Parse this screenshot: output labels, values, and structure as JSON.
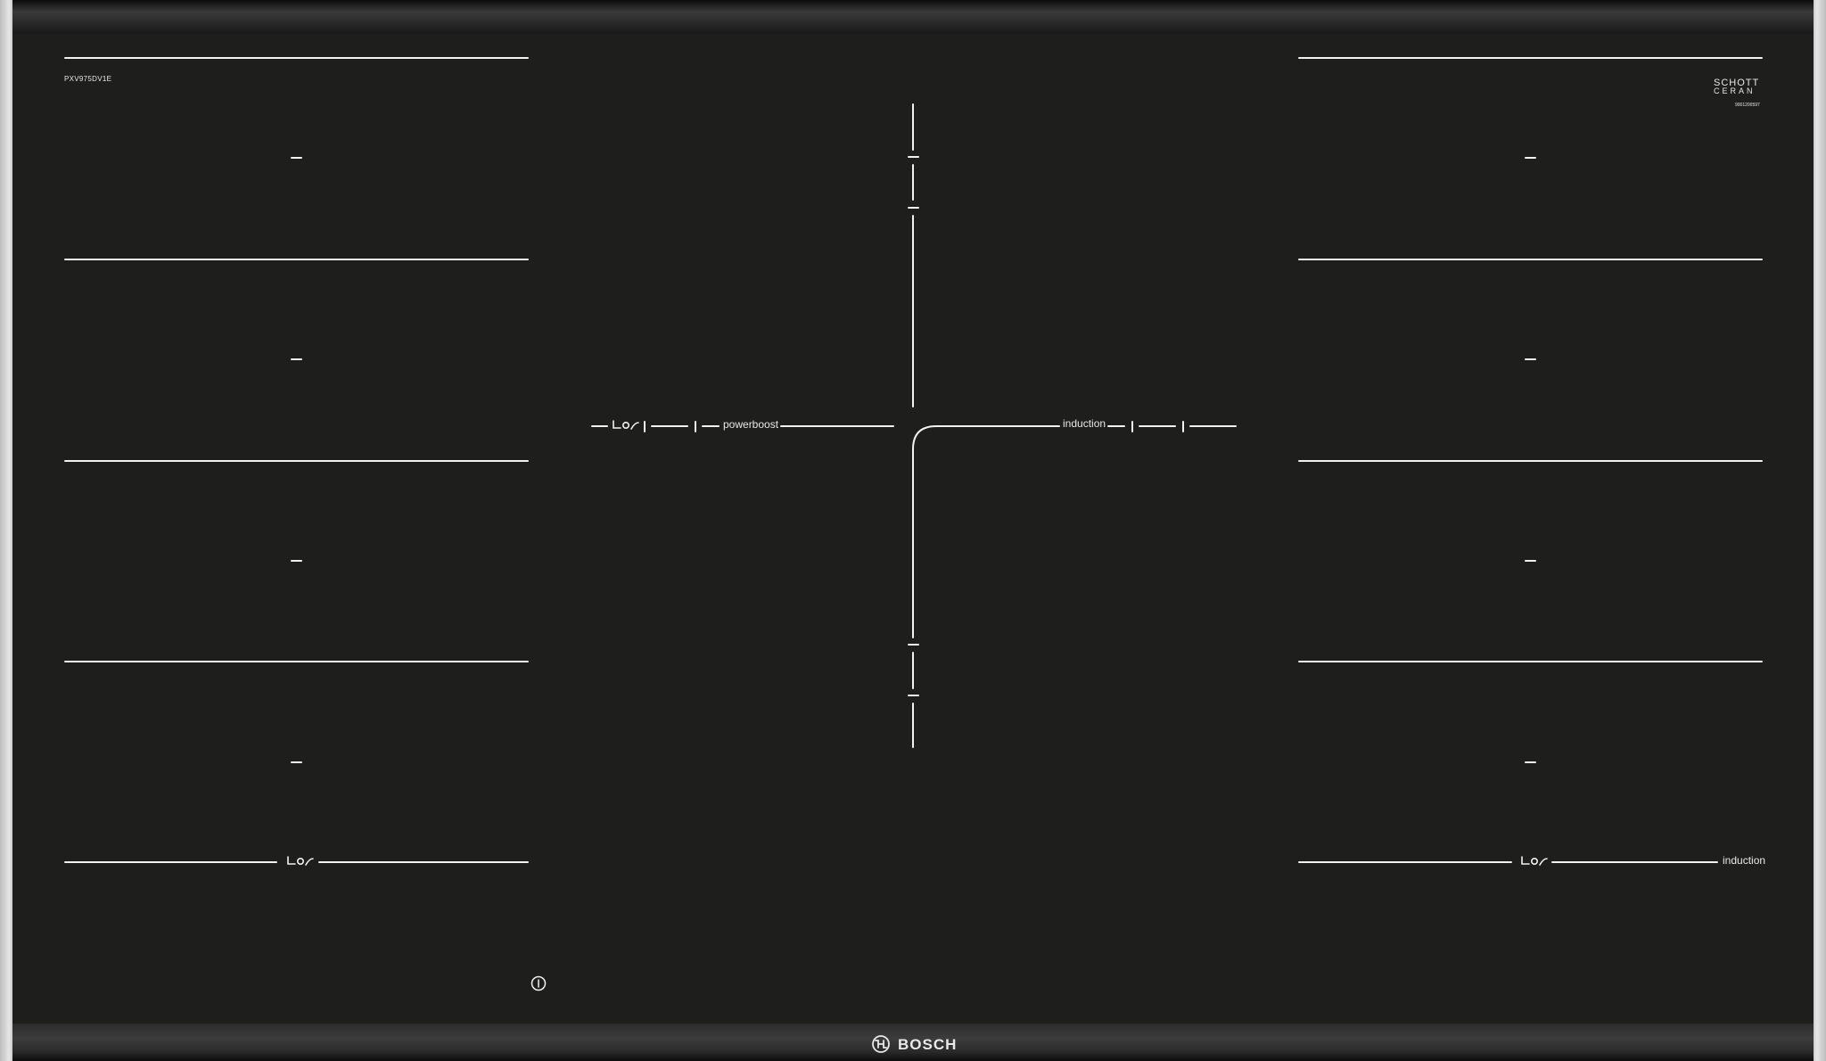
{
  "model_number": "PXV975DV1E",
  "glass_brand": {
    "line1": "SCHOTT",
    "line2": "CERAN",
    "code": "9001200597"
  },
  "labels": {
    "powerboost": "powerboost",
    "induction_center": "induction",
    "induction_right": "induction"
  },
  "brand": {
    "name": "BOSCH"
  },
  "icons": {
    "flex_zone": "flex-zone-icon",
    "info": "info-icon",
    "bosch_logo": "bosch-armature-icon"
  },
  "colors": {
    "glass": "#1e1e1c",
    "lines": "#f2f2f2",
    "frame": "#c9c9c9"
  }
}
